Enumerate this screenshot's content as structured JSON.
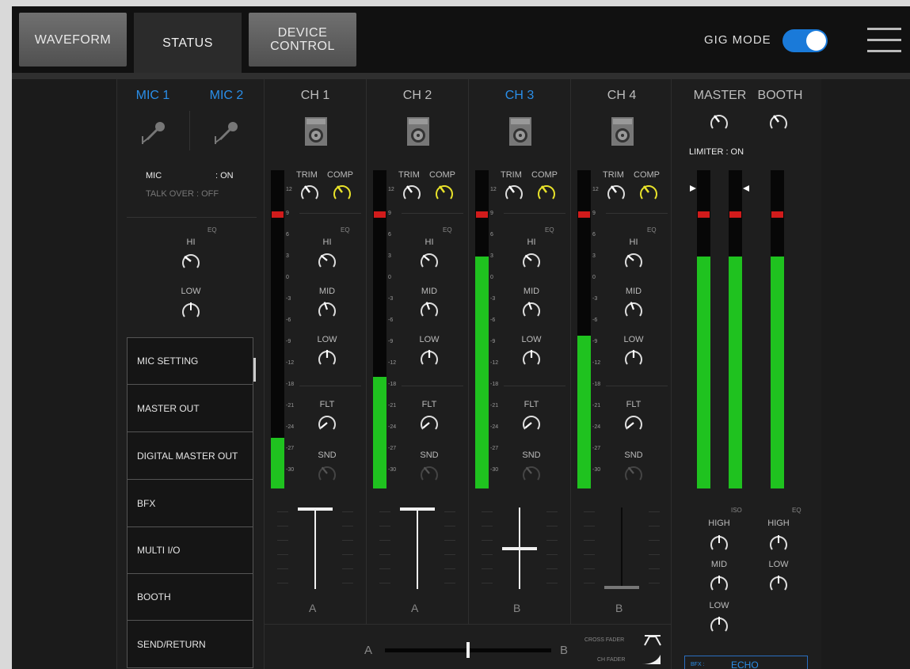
{
  "tabs": [
    {
      "label": "WAVEFORM",
      "state": "inactive"
    },
    {
      "label": "STATUS",
      "state": "active"
    },
    {
      "label": "DEVICE\nCONTROL",
      "state": "inactive"
    }
  ],
  "gig_mode": {
    "label": "GIG MODE",
    "on": true
  },
  "mic": {
    "mic1": "MIC 1",
    "mic2": "MIC 2",
    "status_mic_label": "MIC",
    "status_mic_value": ": ON",
    "talkover": "TALK OVER : OFF",
    "eq_label": "EQ",
    "hi": "HI",
    "low": "LOW"
  },
  "side_menu": [
    "MIC SETTING",
    "MASTER OUT",
    "DIGITAL MASTER OUT",
    "BFX",
    "MULTI I/O",
    "BOOTH",
    "SEND/RETURN"
  ],
  "channels": [
    {
      "name": "CH 1",
      "active": false,
      "assign": "A",
      "level": 0.16,
      "fader": 1.0,
      "peak": true
    },
    {
      "name": "CH 2",
      "active": false,
      "assign": "A",
      "level": 0.35,
      "fader": 1.0,
      "peak": true
    },
    {
      "name": "CH 3",
      "active": true,
      "assign": "B",
      "level": 0.73,
      "fader": 0.5,
      "peak": true
    },
    {
      "name": "CH 4",
      "active": false,
      "assign": "B",
      "level": 0.48,
      "fader": 0.0,
      "peak": true
    }
  ],
  "channel_labels": {
    "trim": "TRIM",
    "comp": "COMP",
    "eq": "EQ",
    "hi": "HI",
    "mid": "MID",
    "low": "LOW",
    "flt": "FLT",
    "snd": "SND"
  },
  "meter_ticks": [
    "12",
    "9",
    "6",
    "3",
    "0",
    "-3",
    "-6",
    "-9",
    "-12",
    "-18",
    "-21",
    "-24",
    "-27",
    "-30"
  ],
  "master": {
    "master_label": "MASTER",
    "booth_label": "BOOTH",
    "limiter": "LIMITER : ON",
    "iso": "ISO",
    "eq": "EQ",
    "master_high": "HIGH",
    "master_mid": "MID",
    "master_low": "LOW",
    "booth_high": "HIGH",
    "booth_low": "LOW",
    "bfx_label": "BFX :",
    "bfx_value": "ECHO",
    "level_l": 0.73,
    "level_r": 0.73,
    "level_booth": 0.73
  },
  "crossfader": {
    "a": "A",
    "b": "B",
    "cf_label": "CROSS FADER",
    "ch_label": "CH FADER",
    "position": 0.5
  },
  "colors": {
    "accent": "#2a8ee8",
    "meter_green": "#1fc21f",
    "peak_red": "#d11b1b",
    "comp_knob": "#e8e22a"
  }
}
